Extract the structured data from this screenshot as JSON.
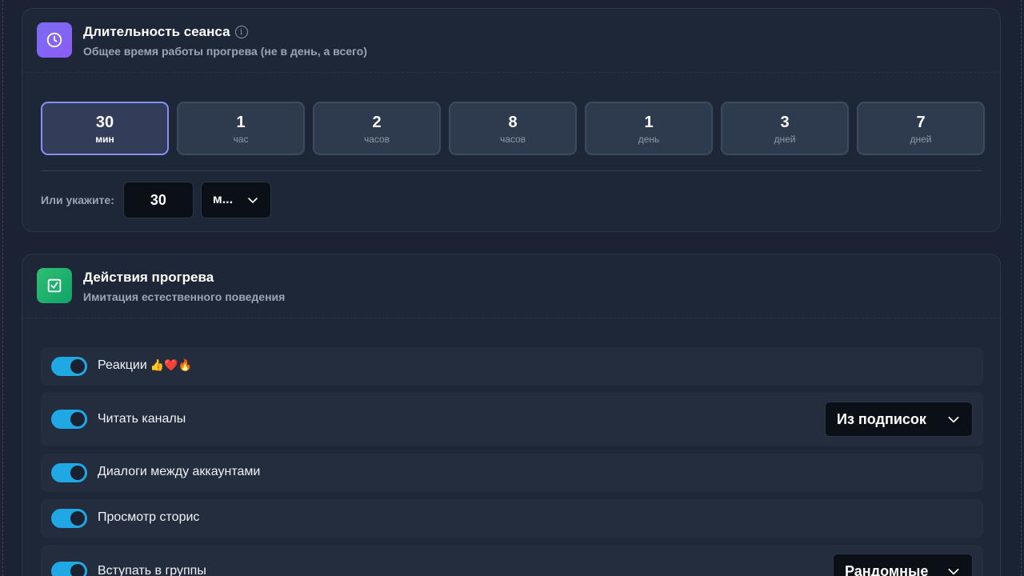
{
  "session": {
    "title": "Длительность сеанса",
    "subtitle": "Общее время работы прогрева (не в день, а всего)",
    "presets": [
      {
        "value": "30",
        "unit": "мин",
        "active": true
      },
      {
        "value": "1",
        "unit": "час",
        "active": false
      },
      {
        "value": "2",
        "unit": "часов",
        "active": false
      },
      {
        "value": "8",
        "unit": "часов",
        "active": false
      },
      {
        "value": "1",
        "unit": "день",
        "active": false
      },
      {
        "value": "3",
        "unit": "дней",
        "active": false
      },
      {
        "value": "7",
        "unit": "дней",
        "active": false
      }
    ],
    "custom_label": "Или укажите:",
    "custom_value": "30",
    "custom_unit": "м..."
  },
  "actions": {
    "title": "Действия прогрева",
    "subtitle": "Имитация естественного поведения",
    "items": [
      {
        "label": "Реакции",
        "emoji": "👍❤️🔥",
        "enabled": true
      },
      {
        "label": "Читать каналы",
        "enabled": true,
        "dropdown": "Из подписок"
      },
      {
        "label": "Диалоги между аккаунтами",
        "enabled": true
      },
      {
        "label": "Просмотр сторис",
        "enabled": true
      },
      {
        "label": "Вступать в группы",
        "enabled": true,
        "dropdown": "Рандомные"
      }
    ]
  },
  "colors": {
    "accent_toggle": "#1fa8e4",
    "active_preset_border": "#8b8ff5",
    "session_icon": "#8b5cf6",
    "actions_icon": "#10a36a"
  }
}
